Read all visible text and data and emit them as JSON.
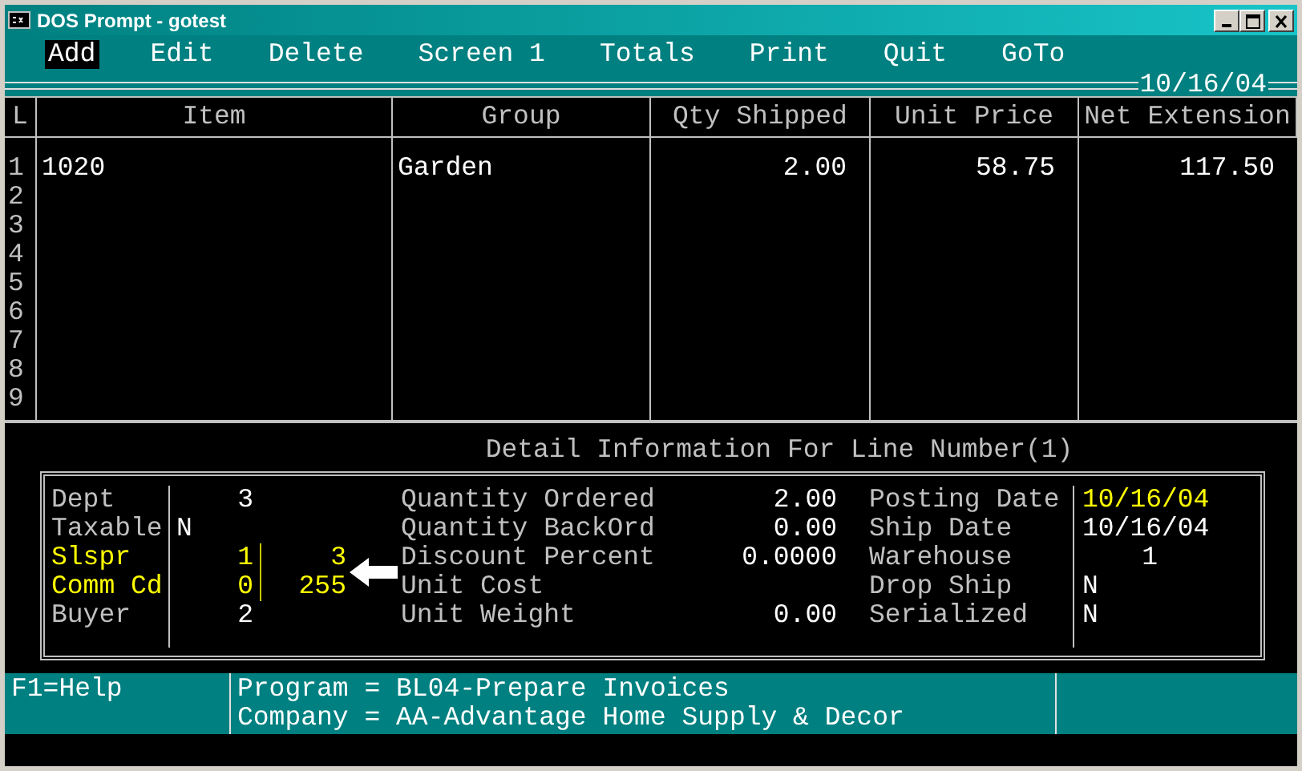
{
  "window": {
    "title": "DOS Prompt - gotest"
  },
  "menu": [
    {
      "label": "Add",
      "selected": true
    },
    {
      "label": "Edit",
      "selected": false
    },
    {
      "label": "Delete",
      "selected": false
    },
    {
      "label": "Screen 1",
      "selected": false
    },
    {
      "label": "Totals",
      "selected": false
    },
    {
      "label": "Print",
      "selected": false
    },
    {
      "label": "Quit",
      "selected": false
    },
    {
      "label": "GoTo",
      "selected": false
    }
  ],
  "date": "10/16/04",
  "table": {
    "columns": [
      "L",
      "Item",
      "Group",
      "Qty Shipped",
      "Unit Price",
      "Net Extension"
    ],
    "rows": [
      {
        "cells": [
          "1",
          "1020",
          "Garden",
          "2.00",
          "58.75",
          "117.50"
        ]
      },
      {
        "cells": [
          "2"
        ]
      },
      {
        "cells": [
          "3"
        ]
      },
      {
        "cells": [
          "4"
        ]
      },
      {
        "cells": [
          "5"
        ]
      },
      {
        "cells": [
          "6"
        ]
      },
      {
        "cells": [
          "7"
        ]
      },
      {
        "cells": [
          "8"
        ]
      },
      {
        "cells": [
          "9"
        ]
      }
    ]
  },
  "detail": {
    "title": "Detail Information For Line Number(1)",
    "left": [
      {
        "label": "Dept",
        "value": "3",
        "kind": "number",
        "highlighted": false
      },
      {
        "label": "Taxable",
        "value": "N",
        "kind": "flag",
        "highlighted": false
      },
      {
        "label": "Slspr",
        "value": "1",
        "value_2": "3",
        "kind": "number",
        "highlighted": true
      },
      {
        "label": "Comm Cd",
        "value": "0",
        "value_2": "255",
        "kind": "number",
        "highlighted": true
      },
      {
        "label": "Buyer",
        "value": "2",
        "kind": "number",
        "highlighted": false
      }
    ],
    "middle": [
      {
        "label": "Quantity Ordered",
        "value": "2.00"
      },
      {
        "label": "Quantity BackOrd",
        "value": "0.00"
      },
      {
        "label": "Discount Percent",
        "value": "0.0000"
      },
      {
        "label": "Unit Cost"
      },
      {
        "label": "Unit Weight",
        "value": "0.00"
      }
    ],
    "right": [
      {
        "label": "Posting Date",
        "value": "10/16/04",
        "kind": "flag",
        "highlighted": true
      },
      {
        "label": "Ship Date",
        "value": "10/16/04",
        "kind": "flag",
        "highlighted": false
      },
      {
        "label": "Warehouse",
        "value": "1",
        "kind": "number",
        "highlighted": false
      },
      {
        "label": "Drop Ship",
        "value": "N",
        "kind": "flag",
        "highlighted": false
      },
      {
        "label": "Serialized",
        "value": "N",
        "kind": "flag",
        "highlighted": false
      }
    ]
  },
  "status_bar": {
    "help": "F1=Help",
    "lines": [
      "Program = BL04-Prepare Invoices",
      "Company = AA-Advantage Home Supply & Decor"
    ]
  }
}
